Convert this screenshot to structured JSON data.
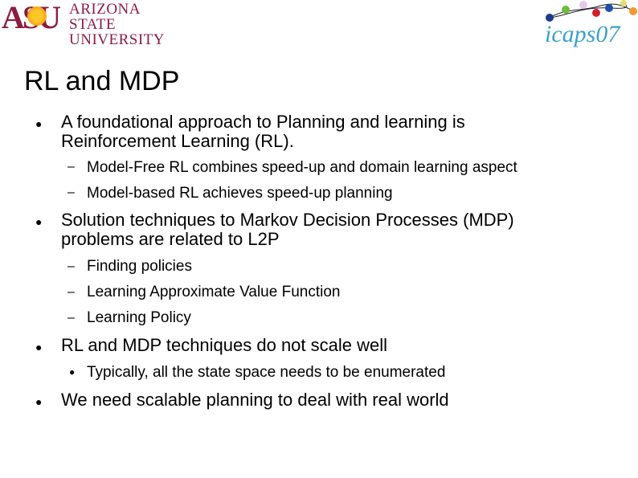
{
  "header": {
    "asu_logo": {
      "mark": "ASU",
      "line1": "ARIZONA STATE",
      "line2": "UNIVERSITY"
    },
    "icaps_logo": {
      "label": "icaps07"
    }
  },
  "slide": {
    "title": "RL and MDP",
    "bullets": [
      {
        "lines": [
          "A foundational approach to Planning and learning is",
          "Reinforcement Learning (RL)."
        ],
        "subs": [
          "Model-Free RL combines speed-up and domain learning aspect",
          "Model-based RL achieves speed-up planning"
        ],
        "sub_marker": "–"
      },
      {
        "lines": [
          "Solution techniques to Markov Decision Processes (MDP)",
          "problems are related to L2P"
        ],
        "subs": [
          "Finding policies",
          "Learning Approximate Value Function",
          "Learning Policy"
        ],
        "sub_marker": "–"
      },
      {
        "lines": [
          "RL and MDP techniques do not scale well"
        ],
        "subs": [
          "Typically, all the state space needs to be enumerated"
        ],
        "sub_marker": "●"
      },
      {
        "lines": [
          "We need scalable planning to deal with real world"
        ],
        "subs": []
      }
    ],
    "bullet_marker": "●"
  }
}
